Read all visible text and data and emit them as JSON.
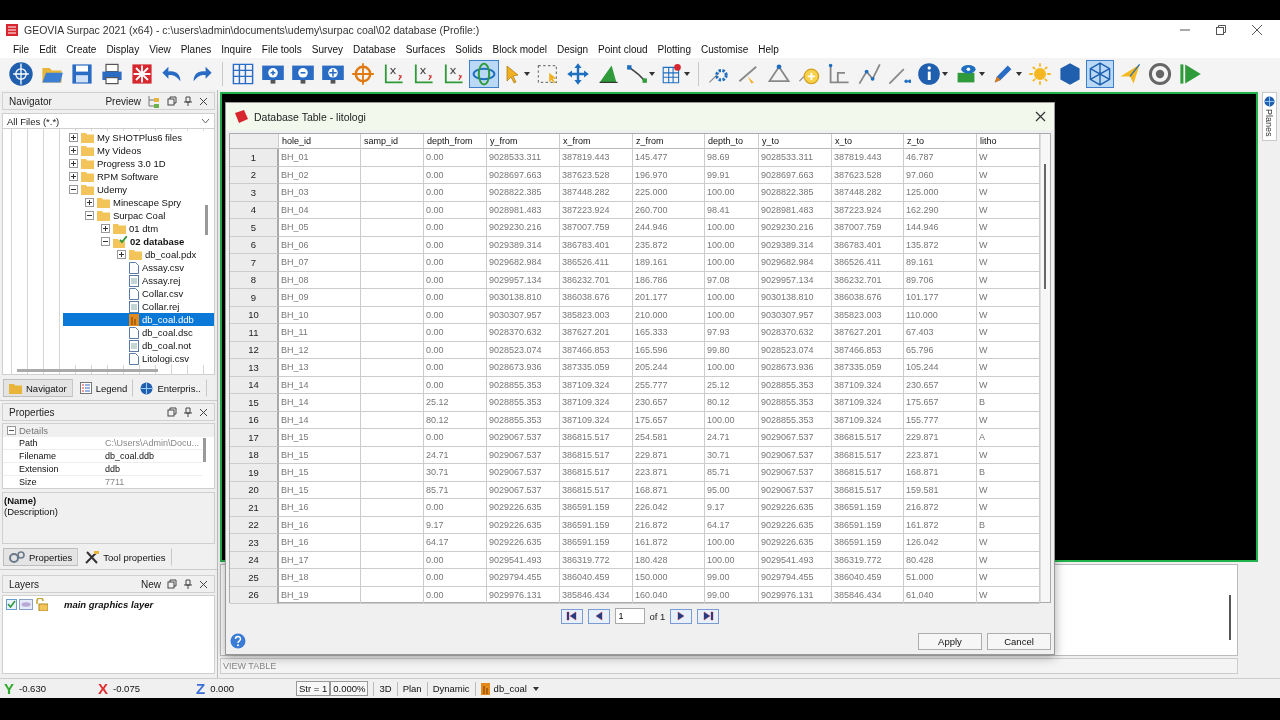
{
  "window": {
    "title": "GEOVIA Surpac 2021 (x64) - c:\\users\\admin\\documents\\udemy\\surpac coal\\02 database (Profile:)"
  },
  "menu": [
    "File",
    "Edit",
    "Create",
    "Display",
    "View",
    "Planes",
    "Inquire",
    "File tools",
    "Survey",
    "Database",
    "Surfaces",
    "Solids",
    "Block model",
    "Design",
    "Point cloud",
    "Plotting",
    "Customise",
    "Help"
  ],
  "toolbar": {
    "groups": [
      [
        {
          "kind": "globe",
          "selected": false
        },
        {
          "kind": "open-folder",
          "selected": false
        },
        {
          "kind": "save",
          "selected": false
        },
        {
          "kind": "printer",
          "selected": false
        },
        {
          "kind": "burst",
          "selected": false
        },
        {
          "kind": "undo",
          "selected": false
        },
        {
          "kind": "redo",
          "selected": false
        }
      ],
      [
        {
          "kind": "grid",
          "selected": false
        },
        {
          "kind": "zoom-in",
          "selected": false
        },
        {
          "kind": "zoom-out",
          "selected": false
        },
        {
          "kind": "zoom-fit",
          "selected": false
        },
        {
          "kind": "crosshair",
          "selected": false
        },
        {
          "kind": "axes",
          "selected": false
        },
        {
          "kind": "axes",
          "selected": false
        },
        {
          "kind": "axes",
          "selected": false
        },
        {
          "kind": "rotate",
          "selected": true
        },
        {
          "kind": "pointer",
          "selected": false
        },
        {
          "kind": "dashed-select",
          "selected": false
        },
        {
          "kind": "move",
          "selected": false
        },
        {
          "kind": "triangle",
          "selected": false
        },
        {
          "kind": "segments",
          "selected": false
        },
        {
          "kind": "red-grid",
          "selected": false
        }
      ],
      [
        {
          "kind": "node-gear",
          "selected": false
        },
        {
          "kind": "node-arrow",
          "selected": false
        },
        {
          "kind": "node-triangle",
          "selected": false
        },
        {
          "kind": "node-plus",
          "selected": false
        },
        {
          "kind": "node-l",
          "selected": false
        },
        {
          "kind": "node-zigzag",
          "selected": false
        },
        {
          "kind": "node-dots",
          "selected": false
        },
        {
          "kind": "info",
          "selected": false
        },
        {
          "kind": "eye",
          "selected": false
        },
        {
          "kind": "pencil",
          "selected": false
        },
        {
          "kind": "sun",
          "selected": false
        },
        {
          "kind": "hexagon",
          "selected": false
        },
        {
          "kind": "wire-hexagon",
          "selected": true
        },
        {
          "kind": "plane",
          "selected": false
        },
        {
          "kind": "ring",
          "selected": false
        },
        {
          "kind": "play",
          "selected": false
        }
      ]
    ]
  },
  "navigator": {
    "title": "Navigator",
    "preview": "Preview",
    "filter": "All Files (*.*)",
    "tree": [
      {
        "label": "My SHOTPlus6 files",
        "kind": "folder",
        "expanded": false,
        "selected": false
      },
      {
        "label": "My Videos",
        "kind": "folder",
        "expanded": false,
        "selected": false
      },
      {
        "label": "Progress 3.0 1D",
        "kind": "folder",
        "expanded": false,
        "selected": false
      },
      {
        "label": "RPM Software",
        "kind": "folder",
        "expanded": false,
        "selected": false
      },
      {
        "label": "Udemy",
        "kind": "folder",
        "expanded": true,
        "selected": false,
        "children": [
          {
            "label": "Minescape Spry",
            "kind": "folder",
            "expanded": false,
            "selected": false
          },
          {
            "label": "Surpac Coal",
            "kind": "folder",
            "expanded": true,
            "selected": false,
            "children": [
              {
                "label": "01 dtm",
                "kind": "folder",
                "expanded": false,
                "selected": false
              },
              {
                "label": "02 database",
                "kind": "working-folder",
                "expanded": true,
                "selected": false,
                "children": [
                  {
                    "label": "db_coal.pdx",
                    "kind": "folder",
                    "expanded": false,
                    "selected": false
                  },
                  {
                    "label": "Assay.csv",
                    "kind": "file",
                    "selected": false
                  },
                  {
                    "label": "Assay.rej",
                    "kind": "log-file",
                    "selected": false
                  },
                  {
                    "label": "Collar.csv",
                    "kind": "file",
                    "selected": false
                  },
                  {
                    "label": "Collar.rej",
                    "kind": "log-file",
                    "selected": false
                  },
                  {
                    "label": "db_coal.ddb",
                    "kind": "database-file",
                    "selected": true
                  },
                  {
                    "label": "db_coal.dsc",
                    "kind": "file",
                    "selected": false
                  },
                  {
                    "label": "db_coal.not",
                    "kind": "log-file",
                    "selected": false
                  },
                  {
                    "label": "Litologi.csv",
                    "kind": "file",
                    "selected": false
                  }
                ]
              }
            ]
          }
        ]
      }
    ],
    "tabs": [
      {
        "label": "Navigator",
        "kind": "folder",
        "selected": true
      },
      {
        "label": "Legend",
        "kind": "list",
        "selected": false
      },
      {
        "label": "Enterpris..",
        "kind": "globe",
        "selected": false
      }
    ]
  },
  "properties": {
    "title": "Properties",
    "group": "Details",
    "expanded": true,
    "rows": [
      {
        "label": "Path",
        "value": "C:\\Users\\Admin\\Docu...",
        "readonly": true
      },
      {
        "label": "Filename",
        "value": "db_coal.ddb",
        "readonly": false
      },
      {
        "label": "Extension",
        "value": "ddb",
        "readonly": false
      },
      {
        "label": "Size",
        "value": "7711",
        "readonly": true
      }
    ],
    "name": "(Name)",
    "description": "(Description)",
    "tabs": [
      {
        "label": "Properties",
        "kind": "gears",
        "selected": true
      },
      {
        "label": "Tool properties",
        "kind": "tools",
        "selected": false
      }
    ]
  },
  "layers": {
    "title": "Layers",
    "new": "New",
    "items": [
      {
        "name": "main graphics layer",
        "checked": true
      }
    ]
  },
  "view_label": "VIEW TABLE",
  "side_tab": "Planes",
  "dialog": {
    "title": "Database Table - litologi",
    "columns": [
      "hole_id",
      "samp_id",
      "depth_from",
      "y_from",
      "x_from",
      "z_from",
      "depth_to",
      "y_to",
      "x_to",
      "z_to",
      "litho"
    ],
    "rows": [
      {
        "num": "1",
        "cells": [
          "BH_01",
          "",
          "0.00",
          "9028533.311",
          "387819.443",
          "145.477",
          "98.69",
          "9028533.311",
          "387819.443",
          "46.787",
          "W"
        ]
      },
      {
        "num": "2",
        "cells": [
          "BH_02",
          "",
          "0.00",
          "9028697.663",
          "387623.528",
          "196.970",
          "99.91",
          "9028697.663",
          "387623.528",
          "97.060",
          "W"
        ]
      },
      {
        "num": "3",
        "cells": [
          "BH_03",
          "",
          "0.00",
          "9028822.385",
          "387448.282",
          "225.000",
          "100.00",
          "9028822.385",
          "387448.282",
          "125.000",
          "W"
        ]
      },
      {
        "num": "4",
        "cells": [
          "BH_04",
          "",
          "0.00",
          "9028981.483",
          "387223.924",
          "260.700",
          "98.41",
          "9028981.483",
          "387223.924",
          "162.290",
          "W"
        ]
      },
      {
        "num": "5",
        "cells": [
          "BH_05",
          "",
          "0.00",
          "9029230.216",
          "387007.759",
          "244.946",
          "100.00",
          "9029230.216",
          "387007.759",
          "144.946",
          "W"
        ]
      },
      {
        "num": "6",
        "cells": [
          "BH_06",
          "",
          "0.00",
          "9029389.314",
          "386783.401",
          "235.872",
          "100.00",
          "9029389.314",
          "386783.401",
          "135.872",
          "W"
        ]
      },
      {
        "num": "7",
        "cells": [
          "BH_07",
          "",
          "0.00",
          "9029682.984",
          "386526.411",
          "189.161",
          "100.00",
          "9029682.984",
          "386526.411",
          "89.161",
          "W"
        ]
      },
      {
        "num": "8",
        "cells": [
          "BH_08",
          "",
          "0.00",
          "9029957.134",
          "386232.701",
          "186.786",
          "97.08",
          "9029957.134",
          "386232.701",
          "89.706",
          "W"
        ]
      },
      {
        "num": "9",
        "cells": [
          "BH_09",
          "",
          "0.00",
          "9030138.810",
          "386038.676",
          "201.177",
          "100.00",
          "9030138.810",
          "386038.676",
          "101.177",
          "W"
        ]
      },
      {
        "num": "10",
        "cells": [
          "BH_10",
          "",
          "0.00",
          "9030307.957",
          "385823.003",
          "210.000",
          "100.00",
          "9030307.957",
          "385823.003",
          "110.000",
          "W"
        ]
      },
      {
        "num": "11",
        "cells": [
          "BH_11",
          "",
          "0.00",
          "9028370.632",
          "387627.201",
          "165.333",
          "97.93",
          "9028370.632",
          "387627.201",
          "67.403",
          "W"
        ]
      },
      {
        "num": "12",
        "cells": [
          "BH_12",
          "",
          "0.00",
          "9028523.074",
          "387466.853",
          "165.596",
          "99.80",
          "9028523.074",
          "387466.853",
          "65.796",
          "W"
        ]
      },
      {
        "num": "13",
        "cells": [
          "BH_13",
          "",
          "0.00",
          "9028673.936",
          "387335.059",
          "205.244",
          "100.00",
          "9028673.936",
          "387335.059",
          "105.244",
          "W"
        ]
      },
      {
        "num": "14",
        "cells": [
          "BH_14",
          "",
          "0.00",
          "9028855.353",
          "387109.324",
          "255.777",
          "25.12",
          "9028855.353",
          "387109.324",
          "230.657",
          "W"
        ]
      },
      {
        "num": "15",
        "cells": [
          "BH_14",
          "",
          "25.12",
          "9028855.353",
          "387109.324",
          "230.657",
          "80.12",
          "9028855.353",
          "387109.324",
          "175.657",
          "B"
        ]
      },
      {
        "num": "16",
        "cells": [
          "BH_14",
          "",
          "80.12",
          "9028855.353",
          "387109.324",
          "175.657",
          "100.00",
          "9028855.353",
          "387109.324",
          "155.777",
          "W"
        ]
      },
      {
        "num": "17",
        "cells": [
          "BH_15",
          "",
          "0.00",
          "9029067.537",
          "386815.517",
          "254.581",
          "24.71",
          "9029067.537",
          "386815.517",
          "229.871",
          "A"
        ]
      },
      {
        "num": "18",
        "cells": [
          "BH_15",
          "",
          "24.71",
          "9029067.537",
          "386815.517",
          "229.871",
          "30.71",
          "9029067.537",
          "386815.517",
          "223.871",
          "W"
        ]
      },
      {
        "num": "19",
        "cells": [
          "BH_15",
          "",
          "30.71",
          "9029067.537",
          "386815.517",
          "223.871",
          "85.71",
          "9029067.537",
          "386815.517",
          "168.871",
          "B"
        ]
      },
      {
        "num": "20",
        "cells": [
          "BH_15",
          "",
          "85.71",
          "9029067.537",
          "386815.517",
          "168.871",
          "95.00",
          "9029067.537",
          "386815.517",
          "159.581",
          "W"
        ]
      },
      {
        "num": "21",
        "cells": [
          "BH_16",
          "",
          "0.00",
          "9029226.635",
          "386591.159",
          "226.042",
          "9.17",
          "9029226.635",
          "386591.159",
          "216.872",
          "W"
        ]
      },
      {
        "num": "22",
        "cells": [
          "BH_16",
          "",
          "9.17",
          "9029226.635",
          "386591.159",
          "216.872",
          "64.17",
          "9029226.635",
          "386591.159",
          "161.872",
          "B"
        ]
      },
      {
        "num": "23",
        "cells": [
          "BH_16",
          "",
          "64.17",
          "9029226.635",
          "386591.159",
          "161.872",
          "100.00",
          "9029226.635",
          "386591.159",
          "126.042",
          "W"
        ]
      },
      {
        "num": "24",
        "cells": [
          "BH_17",
          "",
          "0.00",
          "9029541.493",
          "386319.772",
          "180.428",
          "100.00",
          "9029541.493",
          "386319.772",
          "80.428",
          "W"
        ]
      },
      {
        "num": "25",
        "cells": [
          "BH_18",
          "",
          "0.00",
          "9029794.455",
          "386040.459",
          "150.000",
          "99.00",
          "9029794.455",
          "386040.459",
          "51.000",
          "W"
        ]
      },
      {
        "num": "26",
        "cells": [
          "BH_19",
          "",
          "0.00",
          "9029976.131",
          "385846.434",
          "160.040",
          "99.00",
          "9029976.131",
          "385846.434",
          "61.040",
          "W"
        ]
      }
    ],
    "pager": {
      "page": "1",
      "of": "of 1"
    },
    "buttons": [
      "Apply",
      "Cancel"
    ]
  },
  "status": {
    "coords": [
      {
        "axis": "Y",
        "value": "-0.630",
        "color": "#2eaa2e"
      },
      {
        "axis": "X",
        "value": "-0.075",
        "color": "#e03030"
      },
      {
        "axis": "Z",
        "value": "0.000",
        "color": "#3a6fd8"
      }
    ],
    "str": "Str = 1",
    "percent": "0.000%",
    "modes": [
      "3D",
      "Plan",
      "Dynamic"
    ],
    "database": "db_coal"
  }
}
